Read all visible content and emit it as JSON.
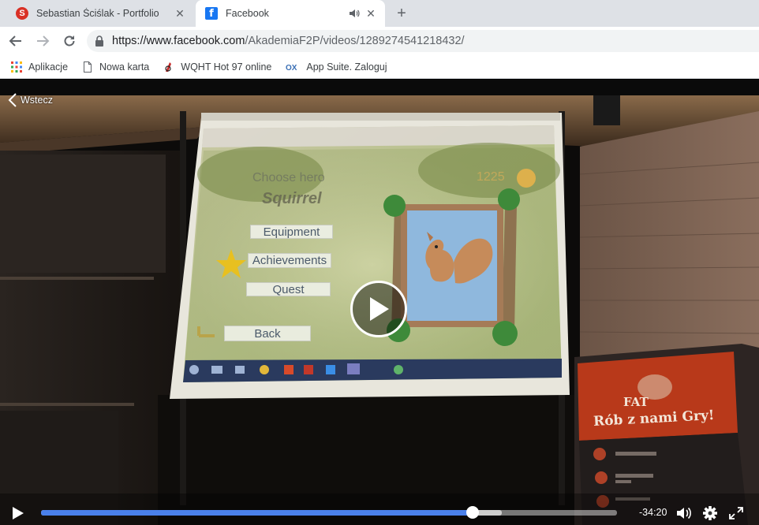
{
  "tabs": [
    {
      "title": "Sebastian Ściślak - Portfolio",
      "favicon": "s-logo-icon",
      "active": false
    },
    {
      "title": "Facebook",
      "favicon": "facebook-icon",
      "active": true,
      "audio": true
    }
  ],
  "toolbar": {
    "url_host": "https://www.facebook.com",
    "url_path": "/AkademiaF2P/videos/1289274541218432/"
  },
  "bookmarks": [
    {
      "label": "Aplikacje",
      "icon": "apps-grid-icon"
    },
    {
      "label": "Nowa karta",
      "icon": "page-icon"
    },
    {
      "label": "WQHT Hot 97 online",
      "icon": "radio-icon"
    },
    {
      "label": "App Suite. Zaloguj",
      "icon": "ox-icon"
    }
  ],
  "video": {
    "back_label": "Wstecz",
    "game": {
      "heading": "Choose hero",
      "hero": "Squirrel",
      "coins": "1225",
      "buttons": [
        "Equipment",
        "Achievements",
        "Quest",
        "Back"
      ]
    },
    "banner": {
      "brand": "FAT",
      "tagline": "Rób z nami Gry!"
    },
    "controls": {
      "time_remaining": "-34:20",
      "progress": 0.749,
      "buffered": 0.8
    }
  }
}
